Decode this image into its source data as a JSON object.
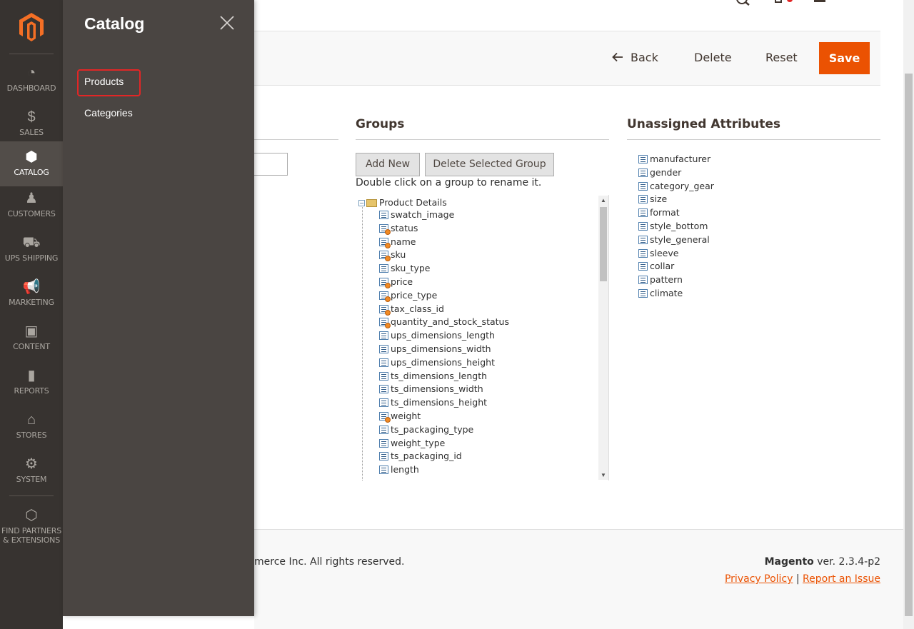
{
  "sidebar": {
    "items": [
      {
        "label": "DASHBOARD",
        "icon": "speedometer-icon"
      },
      {
        "label": "SALES",
        "icon": "dollar-icon"
      },
      {
        "label": "CATALOG",
        "icon": "box-icon"
      },
      {
        "label": "CUSTOMERS",
        "icon": "person-icon"
      },
      {
        "label": "UPS SHIPPING",
        "icon": "truck-icon"
      },
      {
        "label": "MARKETING",
        "icon": "megaphone-icon"
      },
      {
        "label": "CONTENT",
        "icon": "layout-icon"
      },
      {
        "label": "REPORTS",
        "icon": "bar-chart-icon"
      },
      {
        "label": "STORES",
        "icon": "storefront-icon"
      },
      {
        "label": "SYSTEM",
        "icon": "gear-icon"
      },
      {
        "label": "FIND PARTNERS & EXTENSIONS",
        "icon": "blocks-icon"
      }
    ],
    "active": "CATALOG"
  },
  "flyout": {
    "title": "Catalog",
    "links": [
      "Products",
      "Categories"
    ]
  },
  "toolbar": {
    "back_label": "Back",
    "delete_label": "Delete",
    "reset_label": "Reset",
    "save_label": "Save"
  },
  "groups": {
    "title": "Groups",
    "add_new_label": "Add New",
    "delete_group_label": "Delete Selected Group",
    "hint": "Double click on a group to rename it.",
    "root": "Product Details",
    "items": [
      {
        "name": "swatch_image",
        "system": false
      },
      {
        "name": "status",
        "system": true
      },
      {
        "name": "name",
        "system": true
      },
      {
        "name": "sku",
        "system": true
      },
      {
        "name": "sku_type",
        "system": false
      },
      {
        "name": "price",
        "system": true
      },
      {
        "name": "price_type",
        "system": true
      },
      {
        "name": "tax_class_id",
        "system": true
      },
      {
        "name": "quantity_and_stock_status",
        "system": true
      },
      {
        "name": "ups_dimensions_length",
        "system": false
      },
      {
        "name": "ups_dimensions_width",
        "system": false
      },
      {
        "name": "ups_dimensions_height",
        "system": false
      },
      {
        "name": "ts_dimensions_length",
        "system": false
      },
      {
        "name": "ts_dimensions_width",
        "system": false
      },
      {
        "name": "ts_dimensions_height",
        "system": false
      },
      {
        "name": "weight",
        "system": true
      },
      {
        "name": "ts_packaging_type",
        "system": false
      },
      {
        "name": "weight_type",
        "system": false
      },
      {
        "name": "ts_packaging_id",
        "system": false
      },
      {
        "name": "length",
        "system": false
      }
    ]
  },
  "unassigned": {
    "title": "Unassigned Attributes",
    "items": [
      "manufacturer",
      "gender",
      "category_gear",
      "size",
      "format",
      "style_bottom",
      "style_general",
      "sleeve",
      "collar",
      "pattern",
      "climate"
    ]
  },
  "footer": {
    "copyright": "merce Inc. All rights reserved.",
    "brand": "Magento",
    "version": " ver. 2.3.4-p2",
    "privacy_label": "Privacy Policy",
    "separator": " | ",
    "report_label": "Report an Issue"
  },
  "colors": {
    "accent": "#eb5202",
    "sidebar": "#373330",
    "flyout": "#4a4542"
  }
}
